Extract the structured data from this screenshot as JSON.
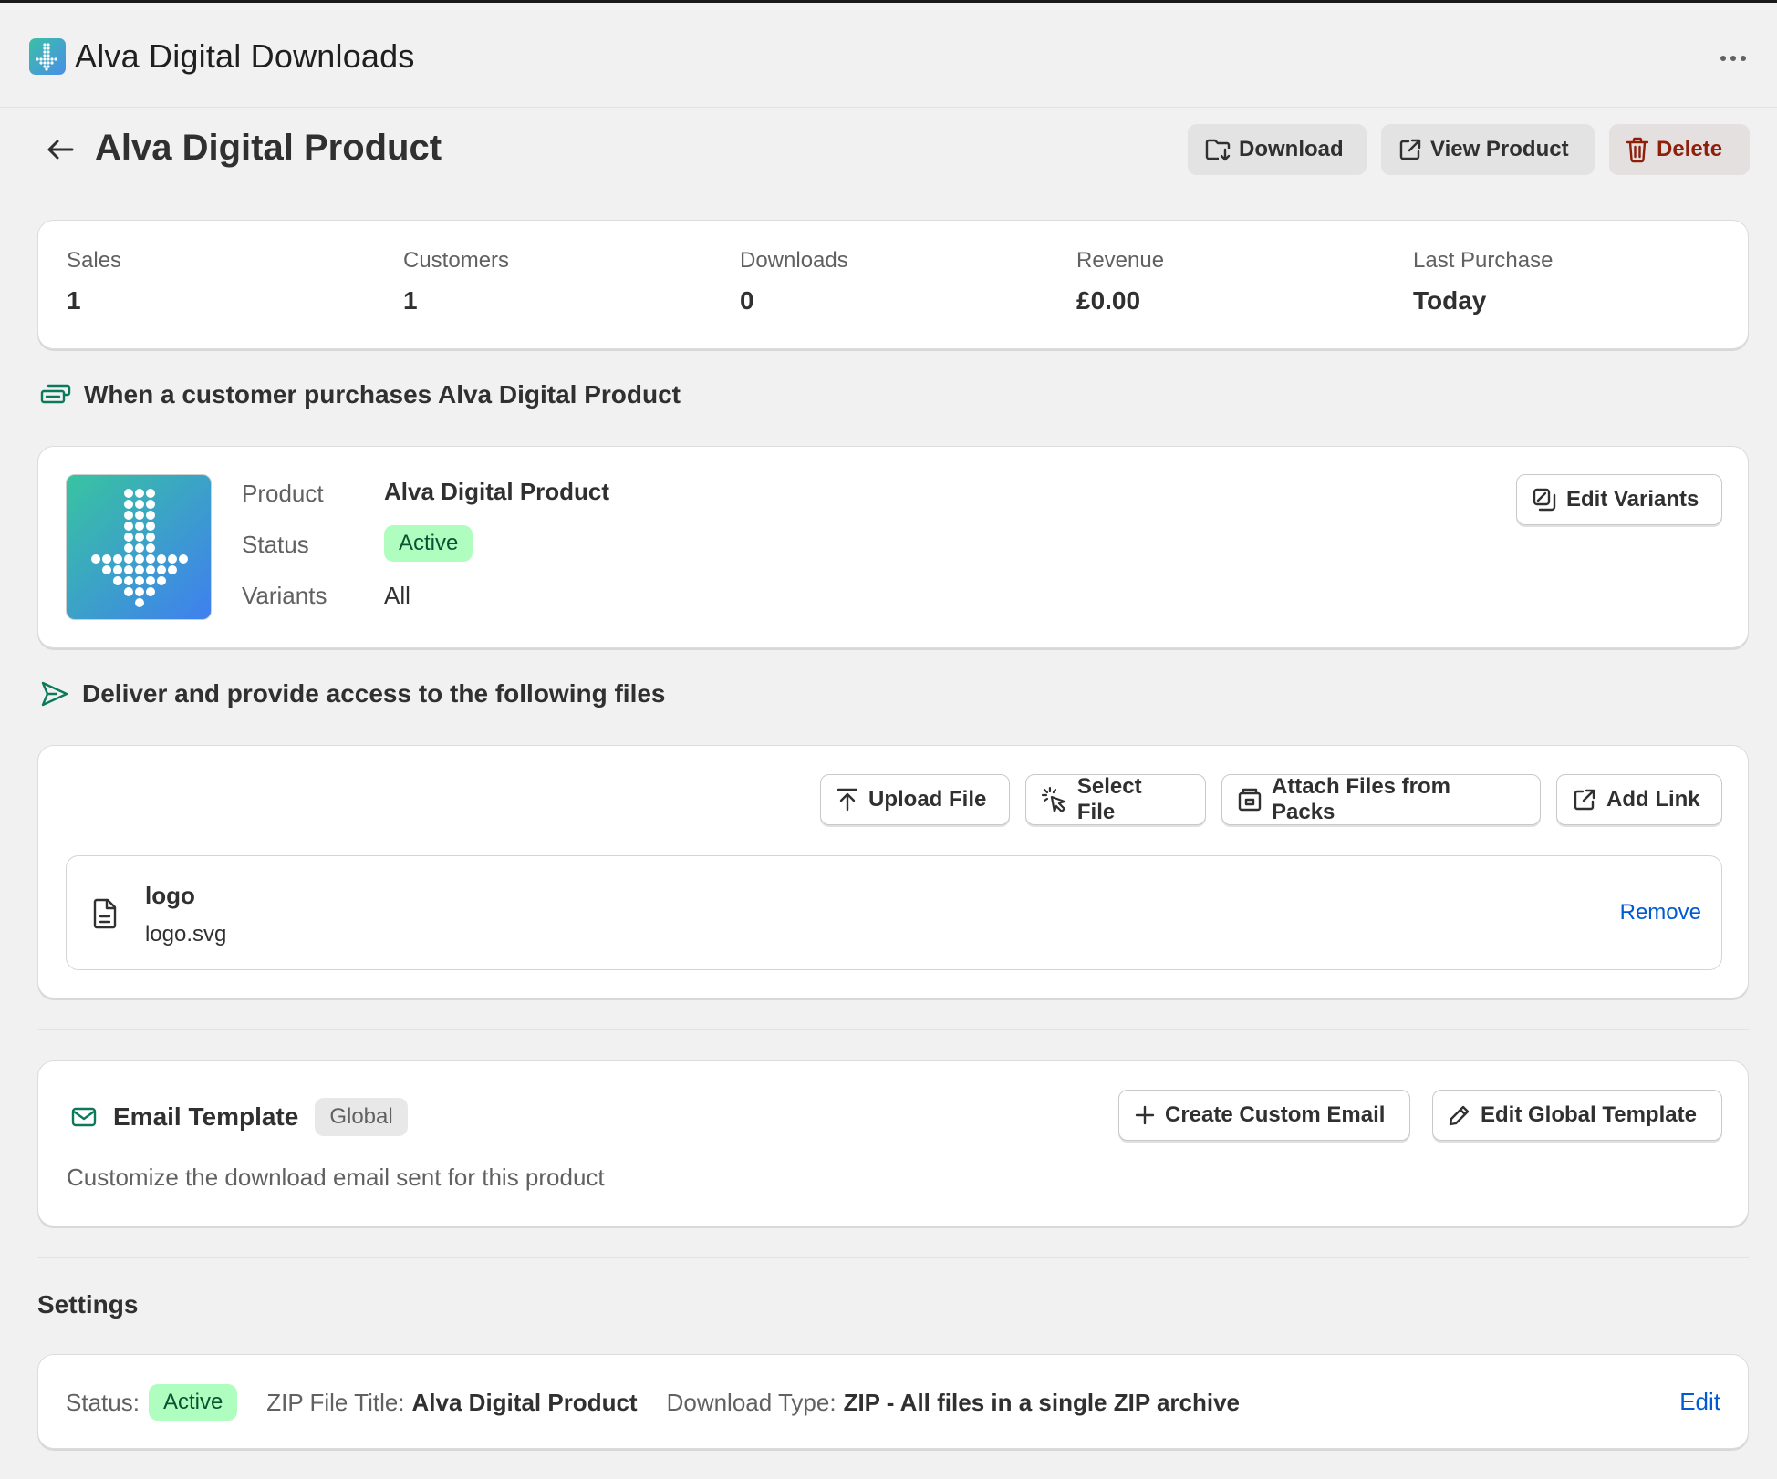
{
  "app": {
    "title": "Alva Digital Downloads",
    "more_label": "More actions"
  },
  "page": {
    "title": "Alva Digital Product",
    "actions": {
      "download": "Download",
      "view_product": "View Product",
      "delete": "Delete"
    }
  },
  "stats": [
    {
      "label": "Sales",
      "value": "1"
    },
    {
      "label": "Customers",
      "value": "1"
    },
    {
      "label": "Downloads",
      "value": "0"
    },
    {
      "label": "Revenue",
      "value": "£0.00"
    },
    {
      "label": "Last Purchase",
      "value": "Today"
    }
  ],
  "trigger": {
    "heading": "When a customer purchases Alva Digital Product",
    "product_label": "Product",
    "product_value": "Alva Digital Product",
    "status_label": "Status",
    "status_value": "Active",
    "variants_label": "Variants",
    "variants_value": "All",
    "edit_variants": "Edit Variants"
  },
  "delivery": {
    "heading": "Deliver and provide access to the following files",
    "buttons": {
      "upload": "Upload File",
      "select": "Select File",
      "attach": "Attach Files from Packs",
      "add_link": "Add Link"
    },
    "files": [
      {
        "title": "logo",
        "filename": "logo.svg",
        "remove": "Remove"
      }
    ]
  },
  "email": {
    "title": "Email Template",
    "badge": "Global",
    "create_custom": "Create Custom Email",
    "edit_global": "Edit Global Template",
    "description": "Customize the download email sent for this product"
  },
  "settings": {
    "title": "Settings",
    "status_label": "Status:",
    "status_value": "Active",
    "zip_label": "ZIP File Title:",
    "zip_value": "Alva Digital Product",
    "type_label": "Download Type:",
    "type_value": "ZIP - All files in a single ZIP archive",
    "edit": "Edit"
  },
  "colors": {
    "accent_link": "#005bd3",
    "success_bg": "#affebf",
    "critical_text": "#8e1f0b",
    "icon_green": "#0c7a5a"
  },
  "icons": [
    "dots-grid-arrow-logo",
    "ellipsis-icon",
    "arrow-left-icon",
    "folder-download-icon",
    "external-link-icon",
    "trash-icon",
    "cash-icon",
    "send-icon",
    "edit-variants-icon",
    "upload-icon",
    "cursor-click-icon",
    "package-icon",
    "file-icon",
    "envelope-icon",
    "plus-icon",
    "pencil-icon"
  ]
}
